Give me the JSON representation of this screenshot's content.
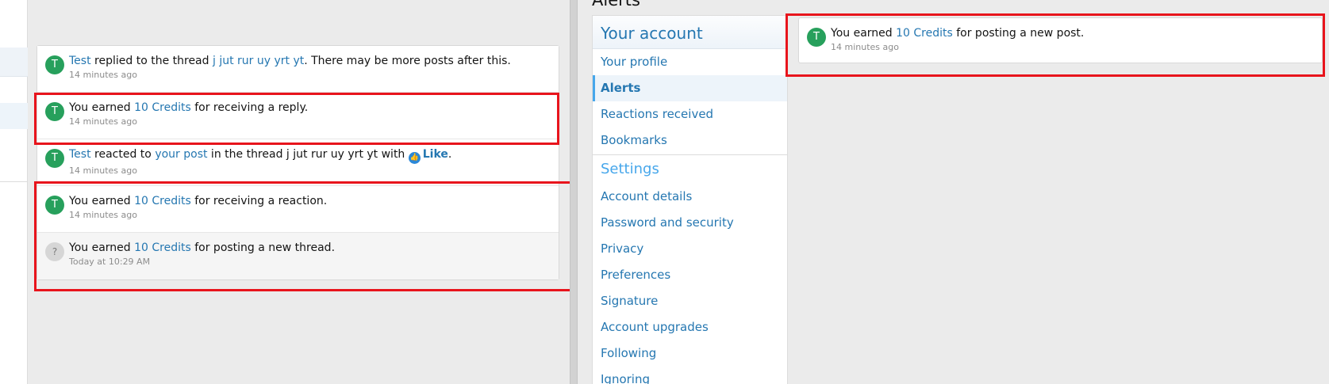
{
  "left": {
    "alerts": [
      {
        "avatar": "T",
        "parts": [
          "Test",
          " replied to the thread ",
          "j jut rur uy yrt yt",
          ". There may be more posts after this."
        ],
        "time": "14 minutes ago"
      },
      {
        "avatar": "T",
        "parts": [
          "You earned ",
          "10 Credits",
          " for receiving a reply."
        ],
        "time": "14 minutes ago"
      },
      {
        "avatar": "T",
        "parts": [
          "Test",
          " reacted to ",
          "your post",
          " in the thread j jut rur uy yrt yt with ",
          "Like",
          "."
        ],
        "time": "14 minutes ago"
      },
      {
        "avatar": "T",
        "parts": [
          "You earned ",
          "10 Credits",
          " for receiving a reaction."
        ],
        "time": "14 minutes ago"
      },
      {
        "avatar": "?",
        "parts": [
          "You earned ",
          "10 Credits",
          " for posting a new thread."
        ],
        "time": "Today at 10:29 AM"
      }
    ]
  },
  "right": {
    "page_heading": "Alerts",
    "nav": {
      "head": "Your account",
      "items": [
        "Your profile",
        "Alerts",
        "Reactions received",
        "Bookmarks"
      ],
      "settings_head": "Settings",
      "settings_items": [
        "Account details",
        "Password and security",
        "Privacy",
        "Preferences",
        "Signature",
        "Account upgrades",
        "Following",
        "Ignoring"
      ]
    },
    "alert": {
      "avatar": "T",
      "parts": [
        "You earned ",
        "10 Credits",
        " for posting a new post."
      ],
      "time": "14 minutes ago"
    }
  },
  "colors": {
    "link": "#2577b1",
    "avatar_green": "#27a05c",
    "highlight_red": "#e8141c",
    "active_nav_bar": "#47a7eb"
  }
}
